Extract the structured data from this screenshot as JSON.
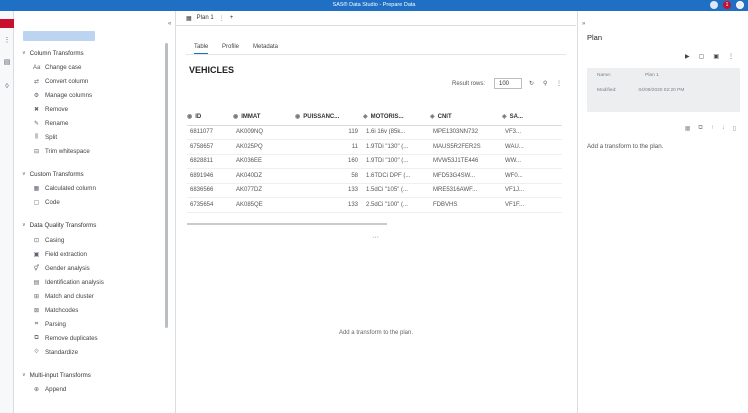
{
  "window": {
    "title": "SAS® Data Studio - Prepare Data",
    "alert_count": "1"
  },
  "left_strip": {
    "icons": [
      "prepare-icon",
      "plan-icon",
      "library-icon",
      "info-icon"
    ]
  },
  "transforms": {
    "groups": [
      {
        "label": "Column Transforms",
        "items": [
          "Change case",
          "Convert column",
          "Manage columns",
          "Remove",
          "Rename",
          "Split",
          "Trim whitespace"
        ]
      },
      {
        "label": "Custom Transforms",
        "items": [
          "Calculated column",
          "Code"
        ]
      },
      {
        "label": "Data Quality Transforms",
        "items": [
          "Casing",
          "Field extraction",
          "Gender analysis",
          "Identification analysis",
          "Match and cluster",
          "Matchcodes",
          "Parsing",
          "Remove duplicates",
          "Standardize"
        ]
      },
      {
        "label": "Multi-input Transforms",
        "items": [
          "Append"
        ]
      }
    ]
  },
  "plan_tab": {
    "label": "Plan 1",
    "add": "+"
  },
  "view_tabs": [
    "Table",
    "Profile",
    "Metadata"
  ],
  "table": {
    "title": "VEHICLES",
    "result_rows_label": "Result rows:",
    "result_rows_value": "100",
    "columns": [
      "ID",
      "IMMAT",
      "PUISSANC...",
      "MOTORIS...",
      "CNIT",
      "SA..."
    ],
    "rows": [
      [
        "6811077",
        "AK009NQ",
        "119",
        "1.6i 16v (85k...",
        "MPE1303NN732",
        "VF3..."
      ],
      [
        "6758657",
        "AK025PQ",
        "11",
        "1.9TDi \"130\" (...",
        "MAUS5R2FER2S",
        "WAU..."
      ],
      [
        "6828811",
        "AK036EE",
        "160",
        "1.9TDi \"100\" (...",
        "MVW53J1TE446",
        "WW..."
      ],
      [
        "6891946",
        "AK040DZ",
        "58",
        "1.6TDCi DPF (...",
        "MFD53G4SW...",
        "WF0..."
      ],
      [
        "6836566",
        "AK077DZ",
        "133",
        "1.5dCi \"105\" (...",
        "MRE5316AWF...",
        "VF1J..."
      ],
      [
        "6735654",
        "AK085QE",
        "133",
        "2.5dCi \"100\" (...",
        "FDBVHS",
        "VF1F..."
      ]
    ],
    "more": "···",
    "empty_message": "Add a transform to the plan."
  },
  "plan_panel": {
    "title": "Plan",
    "meta": [
      {
        "key": "Name:",
        "value": "Plan 1"
      },
      {
        "key": "Modified:",
        "value": "04/09/2020 02:20 PM"
      }
    ],
    "empty_message": "Add a transform to the plan."
  }
}
